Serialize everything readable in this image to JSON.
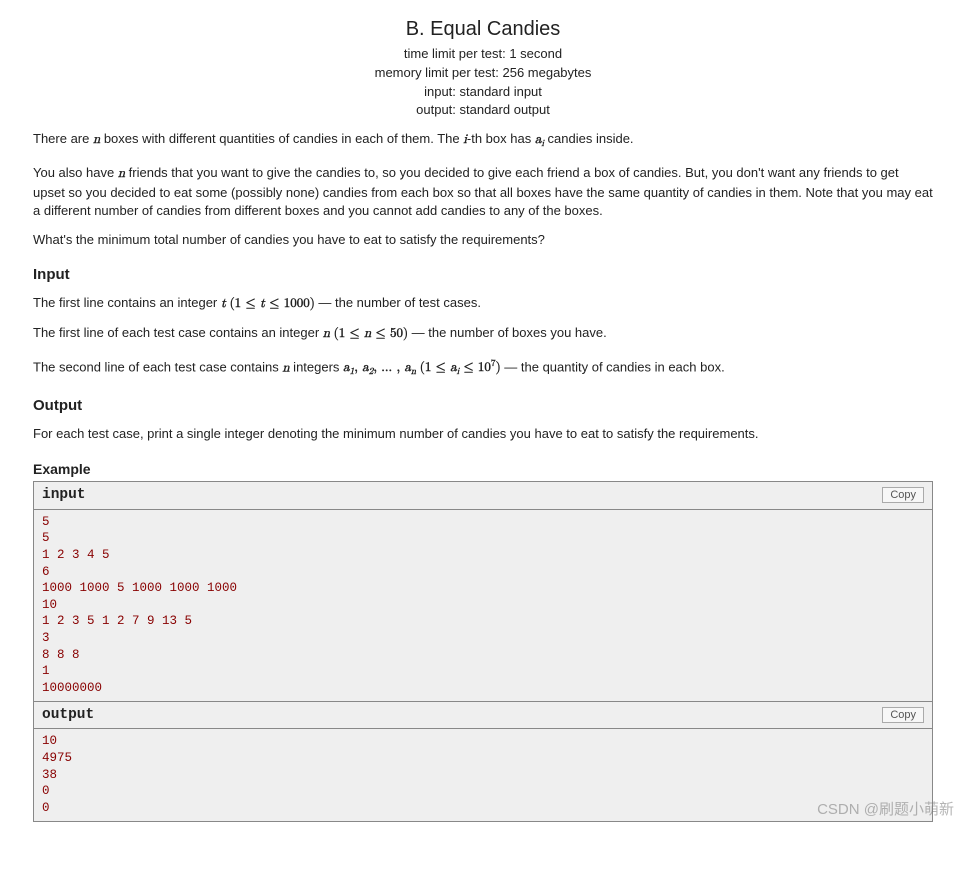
{
  "header": {
    "title": "B. Equal Candies",
    "time_limit": "time limit per test: 1 second",
    "memory_limit": "memory limit per test: 256 megabytes",
    "input_line": "input: standard input",
    "output_line": "output: standard output"
  },
  "statement": {
    "p1a": "There are ",
    "p1b": " boxes with different quantities of candies in each of them. The ",
    "p1c": "-th box has ",
    "p1d": " candies inside.",
    "p2a": "You also have ",
    "p2b": " friends that you want to give the candies to, so you decided to give each friend a box of candies. But, you don't want any friends to get upset so you decided to eat some (possibly none) candies from each box so that all boxes have the same quantity of candies in them. Note that you may eat a different number of candies from different boxes and you cannot add candies to any of the boxes.",
    "p3": "What's the minimum total number of candies you have to eat to satisfy the requirements?"
  },
  "input_section": {
    "heading": "Input",
    "p1a": "The first line contains an integer ",
    "p1b": " — the number of test cases.",
    "p2a": "The first line of each test case contains an integer ",
    "p2b": " — the number of boxes you have.",
    "p3a": "The second line of each test case contains ",
    "p3b": " integers ",
    "p3c": " — the quantity of candies in each box."
  },
  "output_section": {
    "heading": "Output",
    "p1": "For each test case, print a single integer denoting the minimum number of candies you have to eat to satisfy the requirements."
  },
  "example": {
    "heading": "Example",
    "input_label": "input",
    "output_label": "output",
    "copy_label": "Copy",
    "input_data": "5\n5\n1 2 3 4 5\n6\n1000 1000 5 1000 1000 1000\n10\n1 2 3 5 1 2 7 9 13 5\n3\n8 8 8\n1\n10000000",
    "output_data": "10\n4975\n38\n0\n0"
  },
  "math": {
    "n": "n",
    "i": "i",
    "a": "a",
    "t": "t",
    "t_range_open": "(",
    "t_range_close": ")",
    "t_range": "1 ≤ t ≤ 1000",
    "n_range": "1 ≤ n ≤ 50",
    "a_list": "a₁, a₂, … , aₙ",
    "a_range": "1 ≤ aᵢ ≤ 10",
    "a_exp": "7"
  },
  "watermark": "CSDN @刷题小萌新"
}
